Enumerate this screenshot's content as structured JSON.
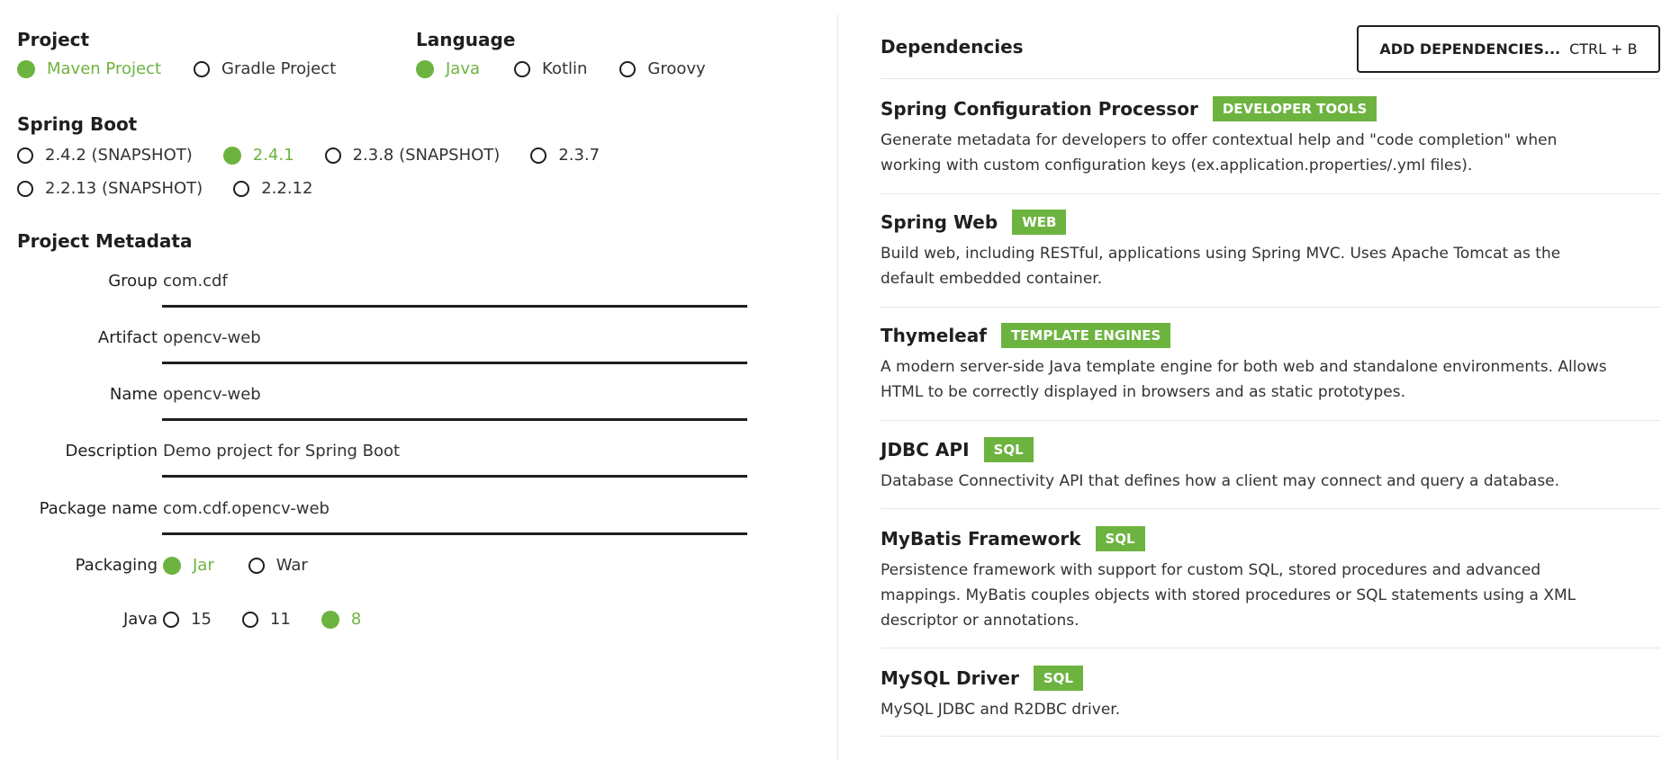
{
  "project": {
    "title": "Project",
    "options": [
      {
        "label": "Maven Project",
        "checked": true
      },
      {
        "label": "Gradle Project",
        "checked": false
      }
    ]
  },
  "language": {
    "title": "Language",
    "options": [
      {
        "label": "Java",
        "checked": true
      },
      {
        "label": "Kotlin",
        "checked": false
      },
      {
        "label": "Groovy",
        "checked": false
      }
    ]
  },
  "spring_boot": {
    "title": "Spring Boot",
    "options": [
      {
        "label": "2.4.2 (SNAPSHOT)",
        "checked": false
      },
      {
        "label": "2.4.1",
        "checked": true
      },
      {
        "label": "2.3.8 (SNAPSHOT)",
        "checked": false
      },
      {
        "label": "2.3.7",
        "checked": false
      },
      {
        "label": "2.2.13 (SNAPSHOT)",
        "checked": false
      },
      {
        "label": "2.2.12",
        "checked": false
      }
    ]
  },
  "metadata": {
    "title": "Project Metadata",
    "fields": [
      {
        "label": "Group",
        "value": "com.cdf"
      },
      {
        "label": "Artifact",
        "value": "opencv-web"
      },
      {
        "label": "Name",
        "value": "opencv-web"
      },
      {
        "label": "Description",
        "value": "Demo project for Spring Boot"
      },
      {
        "label": "Package name",
        "value": "com.cdf.opencv-web"
      }
    ],
    "packaging": {
      "label": "Packaging",
      "options": [
        {
          "label": "Jar",
          "checked": true
        },
        {
          "label": "War",
          "checked": false
        }
      ]
    },
    "java": {
      "label": "Java",
      "options": [
        {
          "label": "15",
          "checked": false
        },
        {
          "label": "11",
          "checked": false
        },
        {
          "label": "8",
          "checked": true
        }
      ]
    }
  },
  "dependencies": {
    "title": "Dependencies",
    "add_button": {
      "label": "ADD DEPENDENCIES...",
      "shortcut": "CTRL + B"
    },
    "items": [
      {
        "name": "Spring Configuration Processor",
        "badge": "DEVELOPER TOOLS",
        "description": "Generate metadata for developers to offer contextual help and \"code completion\" when working with custom configuration keys (ex.application.properties/.yml files)."
      },
      {
        "name": "Spring Web",
        "badge": "WEB",
        "description": "Build web, including RESTful, applications using Spring MVC. Uses Apache Tomcat as the default embedded container."
      },
      {
        "name": "Thymeleaf",
        "badge": "TEMPLATE ENGINES",
        "description": "A modern server-side Java template engine for both web and standalone environments. Allows HTML to be correctly displayed in browsers and as static prototypes."
      },
      {
        "name": "JDBC API",
        "badge": "SQL",
        "description": "Database Connectivity API that defines how a client may connect and query a database."
      },
      {
        "name": "MyBatis Framework",
        "badge": "SQL",
        "description": "Persistence framework with support for custom SQL, stored procedures and advanced mappings. MyBatis couples objects with stored procedures or SQL statements using a XML descriptor or annotations."
      },
      {
        "name": "MySQL Driver",
        "badge": "SQL",
        "description": "MySQL JDBC and R2DBC driver."
      }
    ]
  },
  "colors": {
    "accent": "#6db33f",
    "text": "#1f1f1f",
    "divider": "#e6e6e6"
  }
}
